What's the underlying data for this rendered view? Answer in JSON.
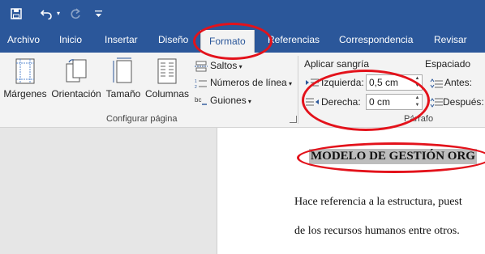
{
  "qat": {
    "save_icon": "save-icon",
    "undo_icon": "undo-icon",
    "redo_icon": "redo-icon",
    "customize_icon": "customize-qat-icon"
  },
  "tabs": [
    {
      "label": "Archivo"
    },
    {
      "label": "Inicio"
    },
    {
      "label": "Insertar"
    },
    {
      "label": "Diseño"
    },
    {
      "label": "Formato"
    },
    {
      "label": "Referencias"
    },
    {
      "label": "Correspondencia"
    },
    {
      "label": "Revisar"
    }
  ],
  "active_tab": "Formato",
  "page_setup": {
    "margins_label": "Márgenes",
    "orientation_label": "Orientación",
    "size_label": "Tamaño",
    "columns_label": "Columnas",
    "breaks_label": "Saltos",
    "line_numbers_label": "Números de línea",
    "hyphenation_label": "Guiones",
    "group_label": "Configurar página"
  },
  "paragraph": {
    "indent_header": "Aplicar sangría",
    "left_label": "Izquierda:",
    "left_value": "0,5 cm",
    "right_label": "Derecha:",
    "right_value": "0 cm",
    "spacing_header": "Espaciado",
    "before_label": "Antes:",
    "after_label": "Después:",
    "group_label": "Párrafo"
  },
  "document": {
    "title": "MODELO DE GESTIÓN ORG",
    "line1": "Hace referencia a la estructura, puest",
    "line2": "de los recursos humanos entre otros."
  },
  "colors": {
    "brand": "#2b579a",
    "ribbon": "#f3f3f3",
    "annotation": "#e3121b"
  }
}
